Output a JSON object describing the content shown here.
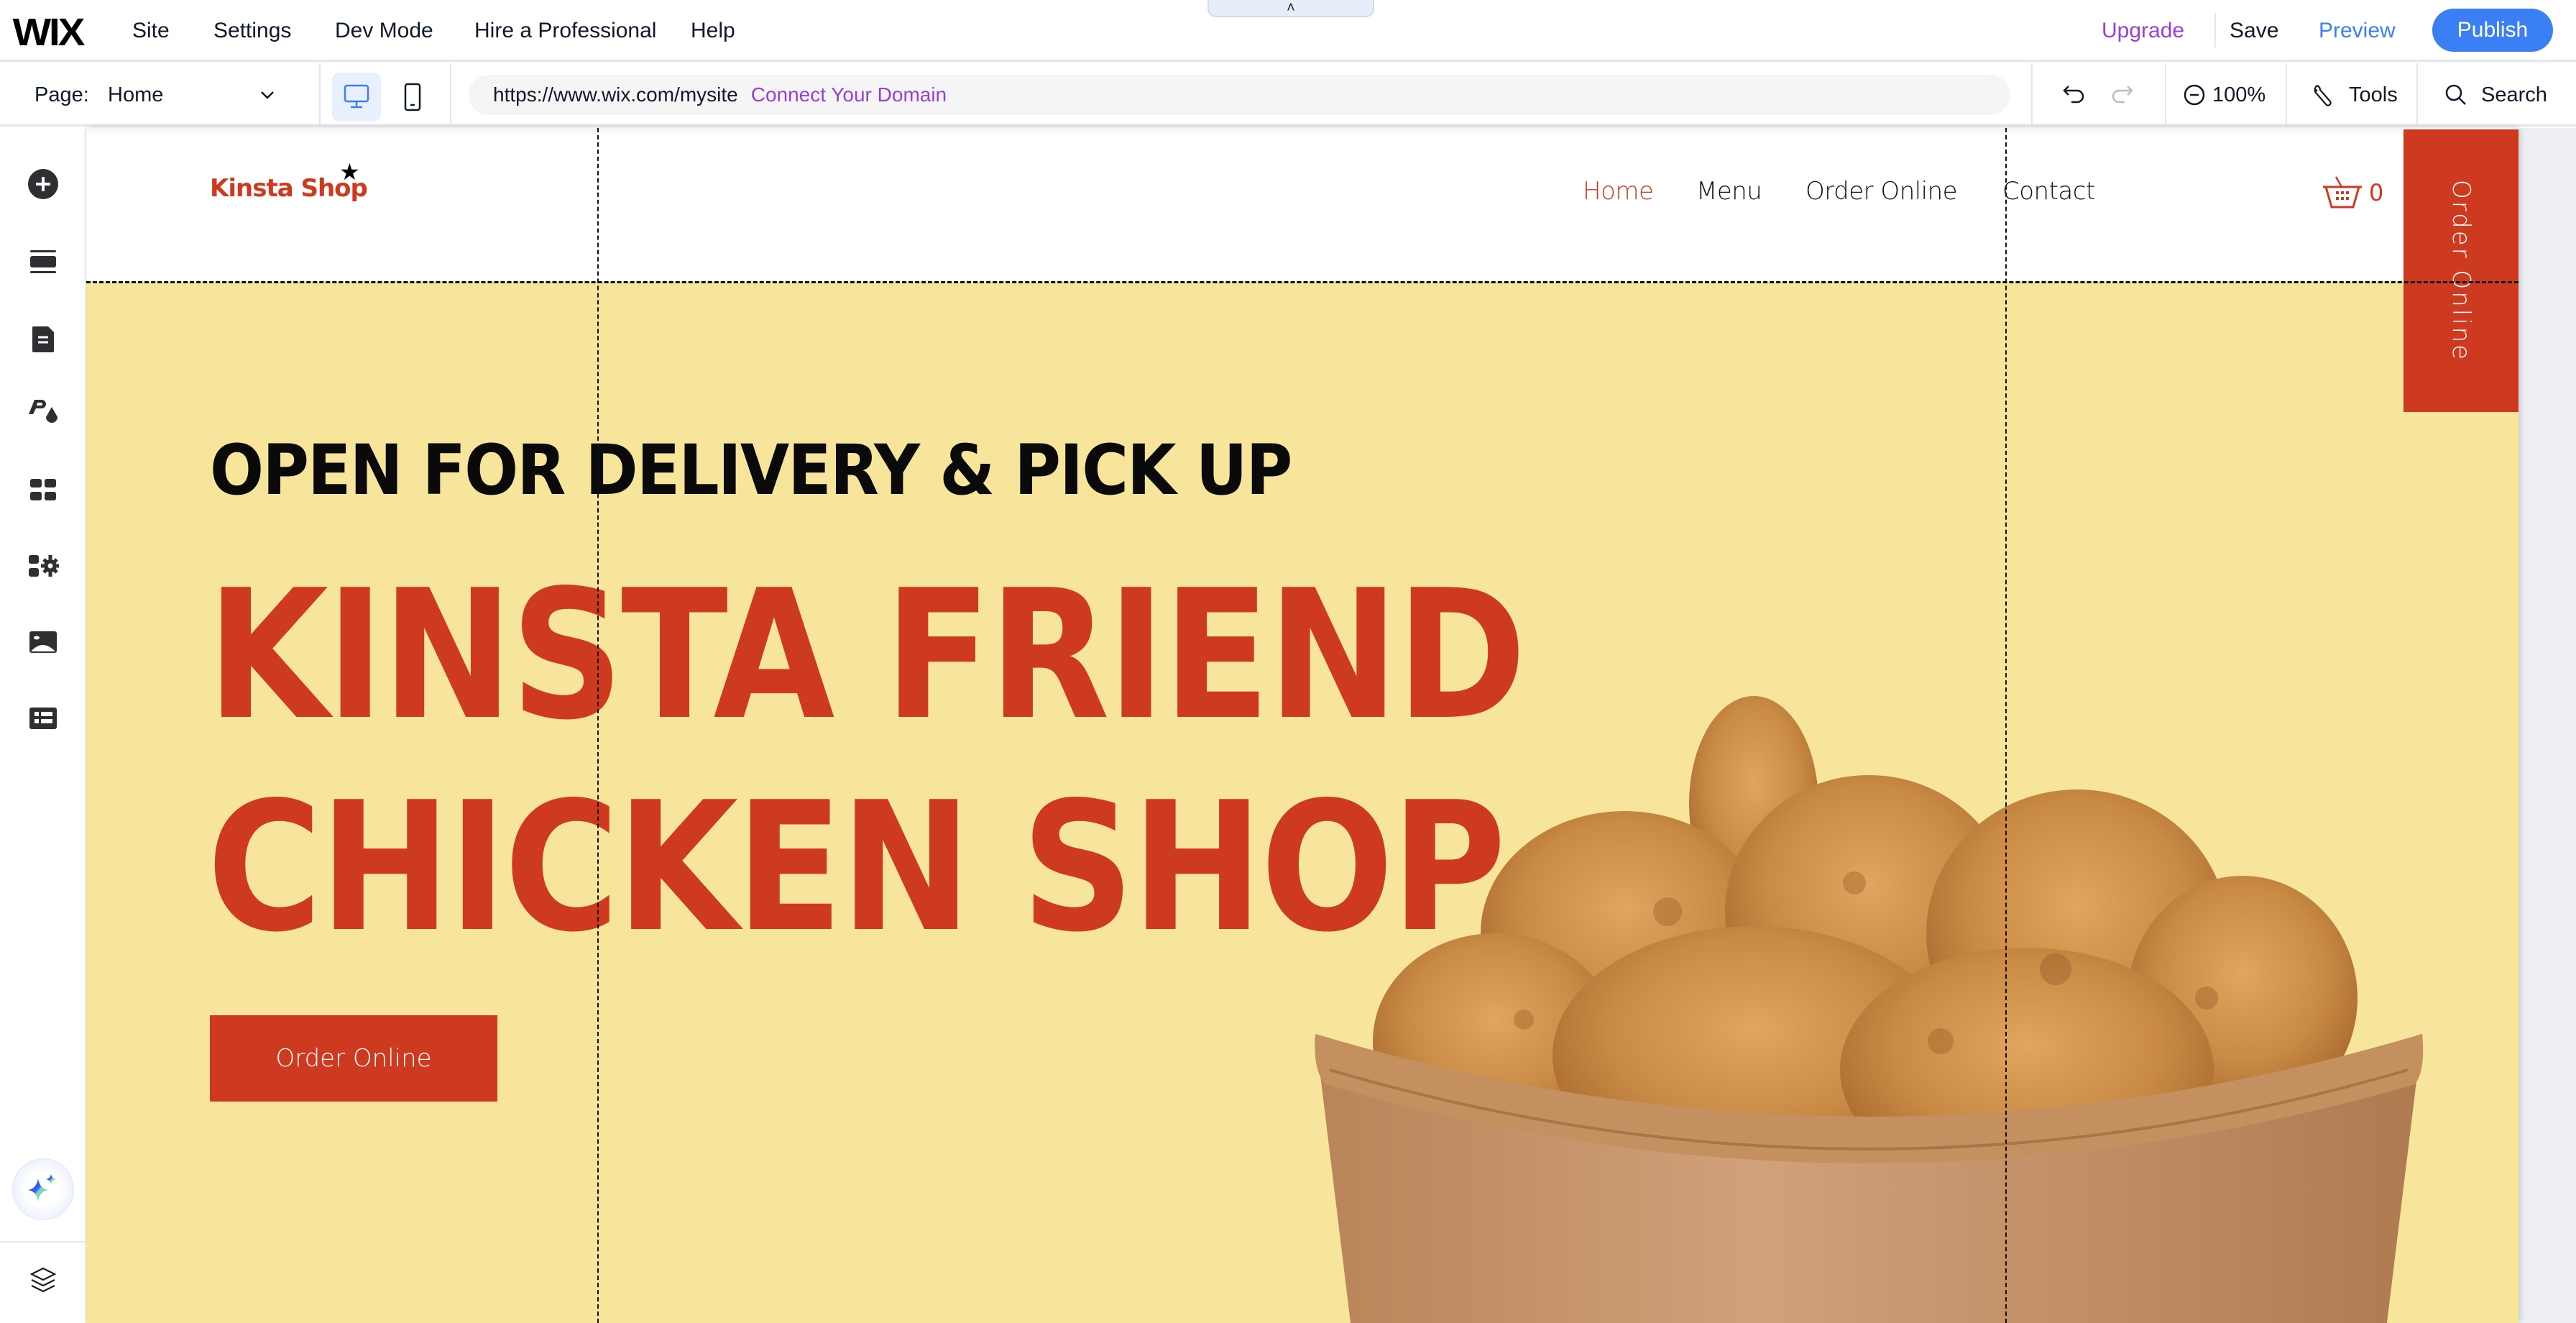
{
  "topbar": {
    "logo": "WIX",
    "menu": [
      "Site",
      "Settings",
      "Dev Mode",
      "Hire a Professional",
      "Help"
    ],
    "collapse_glyph": "˄",
    "upgrade": "Upgrade",
    "save": "Save",
    "preview": "Preview",
    "publish": "Publish"
  },
  "toolbar": {
    "page_label": "Page:",
    "page_value": "Home",
    "url": "https://www.wix.com/mysite",
    "connect_domain": "Connect Your Domain",
    "zoom": "100%",
    "tools": "Tools",
    "search": "Search",
    "active_device": "desktop"
  },
  "sidebar": {
    "items": [
      {
        "name": "add-elements",
        "icon": "plus-circle-icon"
      },
      {
        "name": "sections",
        "icon": "sections-icon"
      },
      {
        "name": "pages",
        "icon": "page-icon"
      },
      {
        "name": "site-design",
        "icon": "theme-icon"
      },
      {
        "name": "apps",
        "icon": "apps-grid-icon"
      },
      {
        "name": "business-apps",
        "icon": "apps-gear-icon"
      },
      {
        "name": "media",
        "icon": "image-icon"
      },
      {
        "name": "cms",
        "icon": "table-icon"
      }
    ],
    "ai_assistant": "sparkle-icon",
    "layers": "layers-icon"
  },
  "site": {
    "logo": "Kinsta Shop",
    "logo_star": "★",
    "nav": [
      "Home",
      "Menu",
      "Order Online",
      "Contact"
    ],
    "nav_active": "Home",
    "cart_count": "0",
    "side_button": "Order Online",
    "hero_subtitle": "OPEN FOR DELIVERY & PICK UP",
    "hero_title_line1": "KINSTA FRIEND",
    "hero_title_line2": "CHICKEN SHOP",
    "hero_button": "Order Online"
  },
  "colors": {
    "brand_red": "#cd3a20",
    "hero_bg": "#f7e59b",
    "wix_blue": "#3b7ff5",
    "upgrade_purple": "#9a3fd6"
  }
}
